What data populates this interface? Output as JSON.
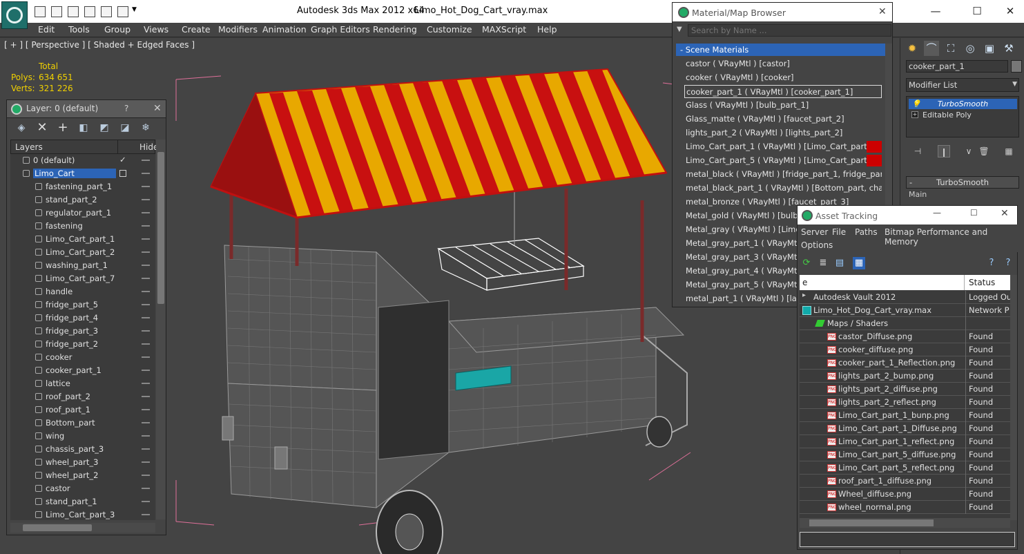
{
  "titlebar": {
    "app_title": "Autodesk 3ds Max  2012 x64",
    "file_name": "Limo_Hot_Dog_Cart_vray.max"
  },
  "menu": [
    "Edit",
    "Tools",
    "Group",
    "Views",
    "Create",
    "Modifiers",
    "Animation",
    "Graph Editors",
    "Rendering",
    "Customize",
    "MAXScript",
    "Help"
  ],
  "viewport": {
    "label": "[ + ] [ Perspective ] [ Shaded + Edged Faces ]",
    "stats": {
      "total_label": "Total",
      "polys_label": "Polys:",
      "polys_value": "634 651",
      "verts_label": "Verts:",
      "verts_value": "321 226"
    }
  },
  "layer_panel": {
    "title": "Layer: 0 (default)",
    "help": "?",
    "close": "✕",
    "col_layers": "Layers",
    "col_hide": "Hide",
    "rows": [
      {
        "name": "0 (default)",
        "level": 0
      },
      {
        "name": "Limo_Cart",
        "level": 0
      },
      {
        "name": "fastening_part_1",
        "level": 1
      },
      {
        "name": "stand_part_2",
        "level": 1
      },
      {
        "name": "regulator_part_1",
        "level": 1
      },
      {
        "name": "fastening",
        "level": 1
      },
      {
        "name": "Limo_Cart_part_1",
        "level": 1
      },
      {
        "name": "Limo_Cart_part_2",
        "level": 1
      },
      {
        "name": "washing_part_1",
        "level": 1
      },
      {
        "name": "Limo_Cart_part_7",
        "level": 1
      },
      {
        "name": "handle",
        "level": 1
      },
      {
        "name": "fridge_part_5",
        "level": 1
      },
      {
        "name": "fridge_part_4",
        "level": 1
      },
      {
        "name": "fridge_part_3",
        "level": 1
      },
      {
        "name": "fridge_part_2",
        "level": 1
      },
      {
        "name": "cooker",
        "level": 1
      },
      {
        "name": "cooker_part_1",
        "level": 1
      },
      {
        "name": "lattice",
        "level": 1
      },
      {
        "name": "roof_part_2",
        "level": 1
      },
      {
        "name": "roof_part_1",
        "level": 1
      },
      {
        "name": "Bottom_part",
        "level": 1
      },
      {
        "name": "wing",
        "level": 1
      },
      {
        "name": "chassis_part_3",
        "level": 1
      },
      {
        "name": "wheel_part_3",
        "level": 1
      },
      {
        "name": "wheel_part_2",
        "level": 1
      },
      {
        "name": "castor",
        "level": 1
      },
      {
        "name": "stand_part_1",
        "level": 1
      },
      {
        "name": "Limo_Cart_part_3",
        "level": 1
      }
    ],
    "selected_index": 1
  },
  "material_browser": {
    "title": "Material/Map Browser",
    "search_placeholder": "Search by Name ...",
    "section": "- Scene Materials",
    "rows": [
      {
        "text": "castor  ( VRayMtl )  [castor]",
        "swatch": false
      },
      {
        "text": "cooker  ( VRayMtl )  [cooker]",
        "swatch": false
      },
      {
        "text": "cooker_part_1  ( VRayMtl )  [cooker_part_1]",
        "swatch": false,
        "selected": true
      },
      {
        "text": "Glass  ( VRayMtl )  [bulb_part_1]",
        "swatch": false
      },
      {
        "text": "Glass_matte  ( VRayMtl )  [faucet_part_2]",
        "swatch": false
      },
      {
        "text": "lights_part_2  ( VRayMtl )  [lights_part_2]",
        "swatch": false
      },
      {
        "text": "Limo_Cart_part_1  ( VRayMtl )  [Limo_Cart_part_1]",
        "swatch": true
      },
      {
        "text": "Limo_Cart_part_5  ( VRayMtl )  [Limo_Cart_part_5]",
        "swatch": true
      },
      {
        "text": "metal_black  ( VRayMtl )  [fridge_part_1, fridge_part...",
        "swatch": false
      },
      {
        "text": "metal_black_part_1  ( VRayMtl )  [Bottom_part, chass...",
        "swatch": false
      },
      {
        "text": "metal_bronze  ( VRayMtl )  [faucet_part_3]",
        "swatch": false
      },
      {
        "text": "Metal_gold  ( VRayMtl )  [bulb_p",
        "swatch": false
      },
      {
        "text": "Metal_gray  ( VRayMtl )  [Limo_",
        "swatch": false
      },
      {
        "text": "Metal_gray_part_1  ( VRayMtl )",
        "swatch": false
      },
      {
        "text": "Metal_gray_part_3  ( VRayMtl )",
        "swatch": false
      },
      {
        "text": "Metal_gray_part_4  ( VRayMtl )",
        "swatch": false
      },
      {
        "text": "Metal_gray_part_5  ( VRayMtl )",
        "swatch": false
      },
      {
        "text": "metal_part_1  ( VRayMtl )  [latc",
        "swatch": false
      }
    ],
    "swatch_color": "#cc0000"
  },
  "command_panel": {
    "object_name": "cooker_part_1",
    "modifier_list": "Modifier List",
    "stack": [
      "TurboSmooth",
      "Editable Poly"
    ],
    "rollout_title": "TurboSmooth",
    "rollout_group": "Main"
  },
  "asset_tracking": {
    "title": "Asset Tracking",
    "menus": [
      "Server",
      "File",
      "Paths",
      "Bitmap Performance and Memory",
      "Options"
    ],
    "col_name": "e",
    "col_status": "Status",
    "rows": [
      {
        "name": "Autodesk Vault 2012",
        "status": "Logged Ou",
        "indent": 0,
        "icon": "vault"
      },
      {
        "name": "Limo_Hot_Dog_Cart_vray.max",
        "status": "Network P",
        "indent": 1,
        "icon": "max"
      },
      {
        "name": "Maps / Shaders",
        "status": "",
        "indent": 2,
        "icon": "folder"
      },
      {
        "name": "castor_Diffuse.png",
        "status": "Found",
        "indent": 3,
        "icon": "png"
      },
      {
        "name": "cooker_diffuse.png",
        "status": "Found",
        "indent": 3,
        "icon": "png"
      },
      {
        "name": "cooker_part_1_Reflection.png",
        "status": "Found",
        "indent": 3,
        "icon": "png"
      },
      {
        "name": "lights_part_2_bump.png",
        "status": "Found",
        "indent": 3,
        "icon": "png"
      },
      {
        "name": "lights_part_2_diffuse.png",
        "status": "Found",
        "indent": 3,
        "icon": "png"
      },
      {
        "name": "lights_part_2_reflect.png",
        "status": "Found",
        "indent": 3,
        "icon": "png"
      },
      {
        "name": "Limo_Cart_part_1_bunp.png",
        "status": "Found",
        "indent": 3,
        "icon": "png"
      },
      {
        "name": "Limo_Cart_part_1_Diffuse.png",
        "status": "Found",
        "indent": 3,
        "icon": "png"
      },
      {
        "name": "Limo_Cart_part_1_reflect.png",
        "status": "Found",
        "indent": 3,
        "icon": "png"
      },
      {
        "name": "Limo_Cart_part_5_diffuse.png",
        "status": "Found",
        "indent": 3,
        "icon": "png"
      },
      {
        "name": "Limo_Cart_part_5_reflect.png",
        "status": "Found",
        "indent": 3,
        "icon": "png"
      },
      {
        "name": "roof_part_1_diffuse.png",
        "status": "Found",
        "indent": 3,
        "icon": "png"
      },
      {
        "name": "Wheel_diffuse.png",
        "status": "Found",
        "indent": 3,
        "icon": "png"
      },
      {
        "name": "wheel_normal.png",
        "status": "Found",
        "indent": 3,
        "icon": "png"
      }
    ],
    "png_badge": "PNG"
  },
  "colors": {
    "selection_blue": "#2c64b6",
    "stats_yellow": "#f0d000",
    "awning_red": "#c81010",
    "awning_yellow": "#f0b000"
  }
}
